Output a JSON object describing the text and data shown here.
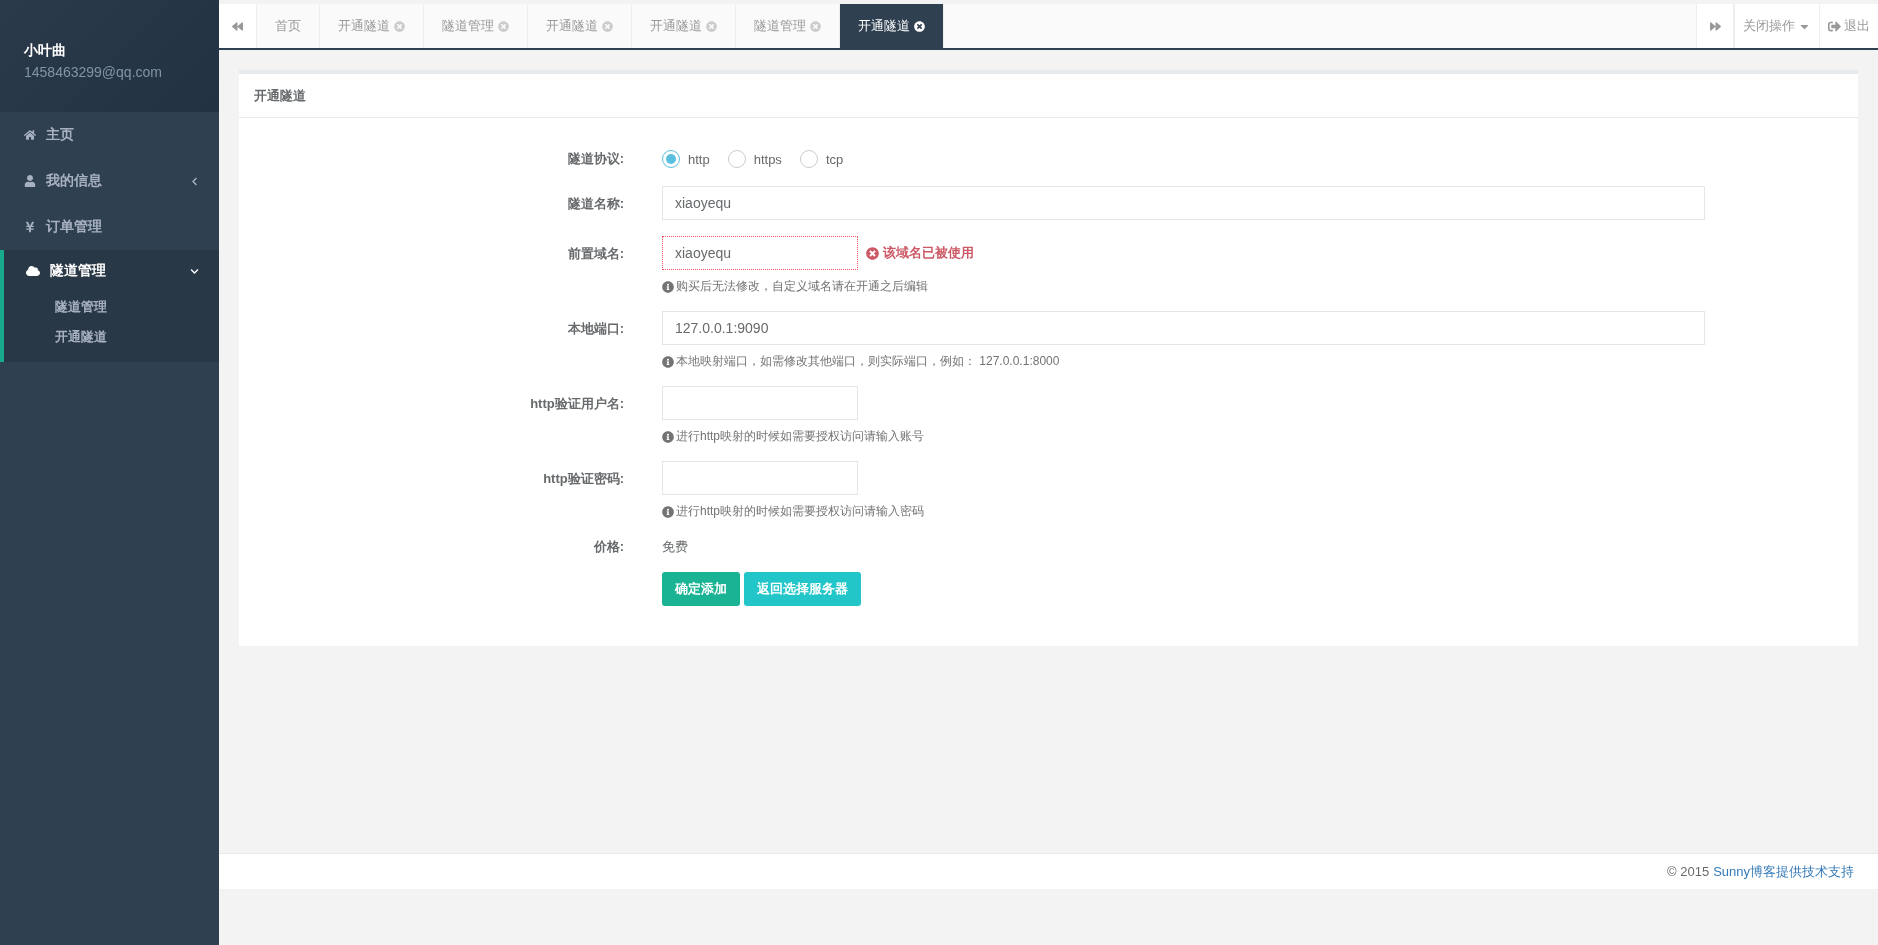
{
  "sidebar": {
    "user": {
      "name": "小叶曲",
      "email": "1458463299@qq.com"
    },
    "items": [
      {
        "label": "主页"
      },
      {
        "label": "我的信息",
        "expanded": false
      },
      {
        "label": "订单管理"
      },
      {
        "label": "隧道管理",
        "expanded": true,
        "children": [
          {
            "label": "隧道管理"
          },
          {
            "label": "开通隧道"
          }
        ]
      }
    ]
  },
  "tabs": [
    {
      "label": "首页",
      "selected": false,
      "closable": false
    },
    {
      "label": "开通隧道",
      "selected": false,
      "closable": true
    },
    {
      "label": "隧道管理",
      "selected": false,
      "closable": true
    },
    {
      "label": "开通隧道",
      "selected": false,
      "closable": true
    },
    {
      "label": "开通隧道",
      "selected": false,
      "closable": true
    },
    {
      "label": "隧道管理",
      "selected": false,
      "closable": true
    },
    {
      "label": "开通隧道",
      "selected": true,
      "closable": true
    }
  ],
  "tab_actions": {
    "close_menu": "关闭操作",
    "logout": "退出"
  },
  "panel": {
    "title": "开通隧道",
    "fields": [
      {
        "kind": "radio",
        "label": "隧道协议:",
        "options": [
          {
            "label": "http",
            "selected": true
          },
          {
            "label": "https",
            "selected": false
          },
          {
            "label": "tcp",
            "selected": false
          }
        ]
      },
      {
        "kind": "wide",
        "label": "隧道名称:",
        "value": "xiaoyequ"
      },
      {
        "kind": "short",
        "label": "前置域名:",
        "value": "xiaoyequ",
        "error": "该域名已被使用",
        "help": "购买后无法修改，自定义域名请在开通之后编辑"
      },
      {
        "kind": "wide",
        "label": "本地端口:",
        "value": "127.0.0.1:9090",
        "help": "本地映射端口，如需修改其他端口，则实际端口，例如： 127.0.0.1:8000"
      },
      {
        "kind": "short",
        "label": "http验证用户名:",
        "help": "进行http映射的时候如需要授权访问请输入账号"
      },
      {
        "kind": "short",
        "label": "http验证密码:",
        "help": "进行http映射的时候如需要授权访问请输入密码"
      },
      {
        "kind": "static",
        "label": "价格:",
        "value": "免费"
      }
    ],
    "buttons": [
      {
        "label": "确定添加",
        "kind": "primary"
      },
      {
        "label": "返回选择服务器",
        "kind": "info"
      }
    ]
  },
  "footer": {
    "text": "© 2015",
    "link": "Sunny博客提供技术支持"
  }
}
